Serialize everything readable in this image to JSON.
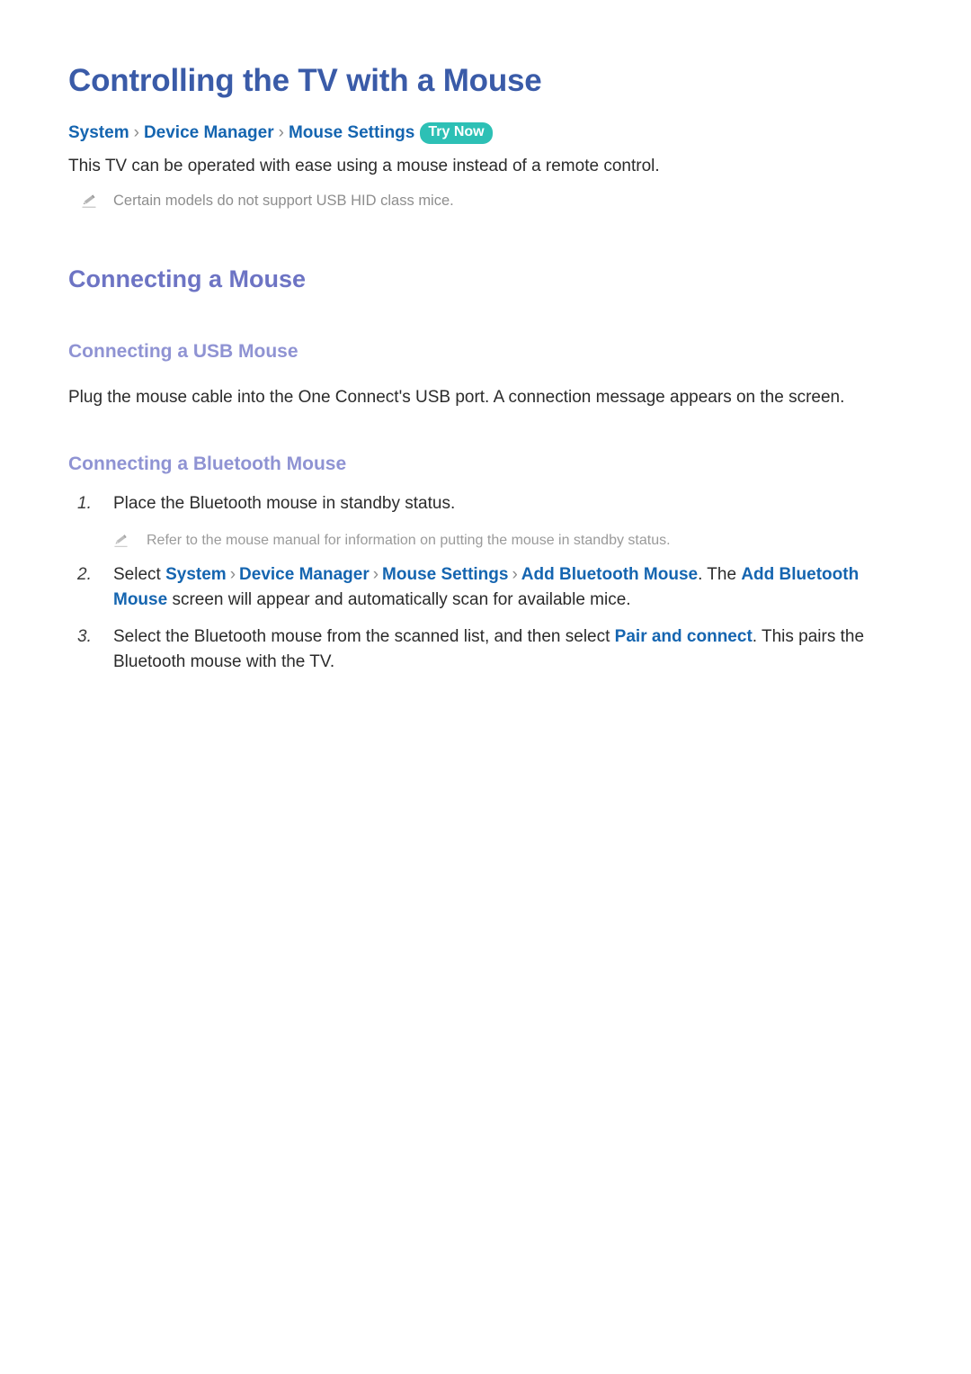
{
  "document": {
    "title": "Controlling the TV with a Mouse",
    "breadcrumb": {
      "items": [
        "System",
        "Device Manager",
        "Mouse Settings"
      ],
      "separator": "›",
      "badge": "Try Now"
    },
    "intro_paragraph": "This TV can be operated with ease using a mouse instead of a remote control.",
    "intro_note": {
      "icon": "pencil-icon",
      "text": "Certain models do not support USB HID class mice."
    },
    "sections": [
      {
        "heading": "Connecting a Mouse",
        "subsections": [
          {
            "heading": "Connecting a USB Mouse",
            "paragraph": "Plug the mouse cable into the One Connect's USB port. A connection message appears on the screen."
          },
          {
            "heading": "Connecting a Bluetooth Mouse",
            "steps": [
              {
                "number": "1.",
                "text": "Place the Bluetooth mouse in standby status.",
                "note": {
                  "icon": "pencil-icon",
                  "text": "Refer to the mouse manual for information on putting the mouse in standby status."
                }
              },
              {
                "number": "2.",
                "parts": [
                  {
                    "type": "text",
                    "value": "Select "
                  },
                  {
                    "type": "link",
                    "value": "System"
                  },
                  {
                    "type": "sep",
                    "value": "›"
                  },
                  {
                    "type": "link",
                    "value": "Device Manager"
                  },
                  {
                    "type": "sep",
                    "value": "›"
                  },
                  {
                    "type": "link",
                    "value": "Mouse Settings"
                  },
                  {
                    "type": "sep",
                    "value": "›"
                  },
                  {
                    "type": "link",
                    "value": "Add Bluetooth Mouse"
                  },
                  {
                    "type": "text",
                    "value": ". The "
                  },
                  {
                    "type": "link",
                    "value": "Add Bluetooth Mouse"
                  },
                  {
                    "type": "text",
                    "value": " screen will appear and automatically scan for available mice."
                  }
                ]
              },
              {
                "number": "3.",
                "parts": [
                  {
                    "type": "text",
                    "value": "Select the Bluetooth mouse from the scanned list, and then select "
                  },
                  {
                    "type": "link",
                    "value": "Pair and connect"
                  },
                  {
                    "type": "text",
                    "value": ". This pairs the Bluetooth mouse with the TV."
                  }
                ]
              }
            ]
          }
        ]
      }
    ]
  },
  "colors": {
    "title": "#3a5ba8",
    "heading2": "#6d74c4",
    "heading3": "#8f93d3",
    "link": "#1565b0",
    "badge_bg": "#2dc0b5",
    "badge_text": "#ffffff",
    "body": "#2b2b2b",
    "note": "#8e8e8e",
    "background": "#ffffff"
  }
}
